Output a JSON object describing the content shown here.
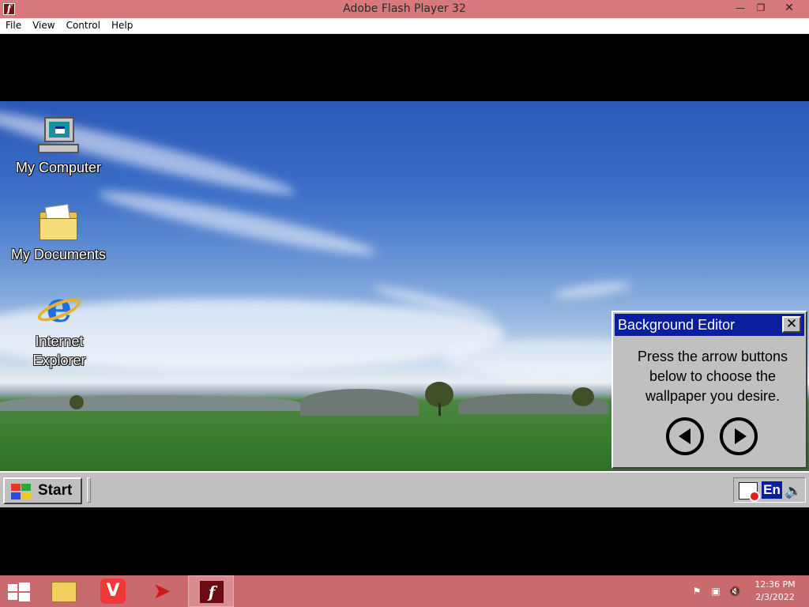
{
  "window": {
    "title": "Adobe Flash Player 32",
    "controls": {
      "minimize": "—",
      "maximize": "❐",
      "close": "✕"
    }
  },
  "menu": [
    "File",
    "View",
    "Control",
    "Help"
  ],
  "desktop": {
    "icons": [
      {
        "label": "My Computer"
      },
      {
        "label": "My Documents"
      },
      {
        "label": "Internet Explorer"
      }
    ]
  },
  "dialog": {
    "title": "Background Editor",
    "close_glyph": "✕",
    "message": "Press the arrow buttons below to choose the wallpaper you desire."
  },
  "taskbar98": {
    "start_label": "Start",
    "language": "En"
  },
  "host_taskbar": {
    "time": "12:36 PM",
    "date": "2/3/2022"
  },
  "colors": {
    "host_taskbar": "#c86a6e",
    "dialog_title": "#0a1e9e",
    "win98_face": "#c0c0c0"
  }
}
